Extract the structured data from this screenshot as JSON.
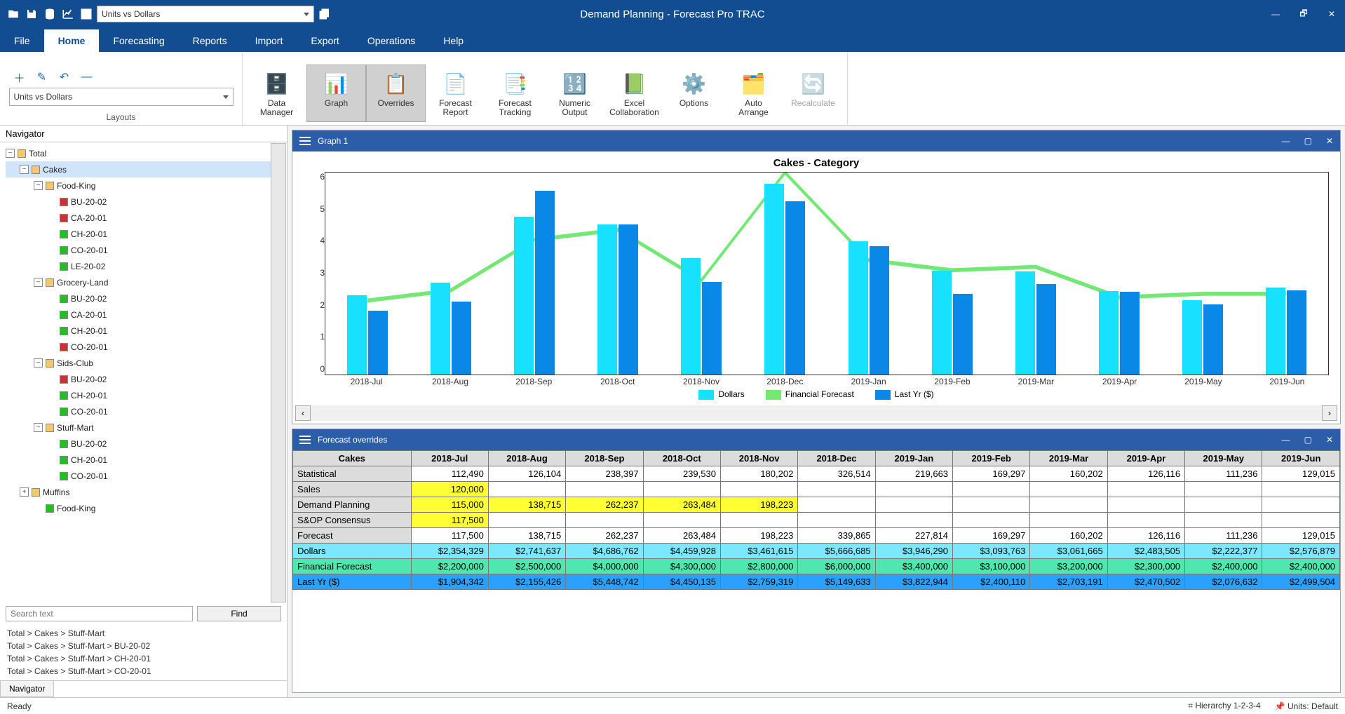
{
  "app_title": "Demand Planning - Forecast Pro TRAC",
  "layout_selected": "Units vs Dollars",
  "menubar": [
    "File",
    "Home",
    "Forecasting",
    "Reports",
    "Import",
    "Export",
    "Operations",
    "Help"
  ],
  "menubar_active": 1,
  "ribbon": {
    "layouts_label": "Layouts",
    "buttons": [
      {
        "label": "Data\nManager"
      },
      {
        "label": "Graph"
      },
      {
        "label": "Overrides"
      },
      {
        "label": "Forecast\nReport"
      },
      {
        "label": "Forecast\nTracking"
      },
      {
        "label": "Numeric\nOutput"
      },
      {
        "label": "Excel\nCollaboration"
      },
      {
        "label": "Options"
      },
      {
        "label": "Auto\nArrange"
      },
      {
        "label": "Recalculate"
      }
    ]
  },
  "navigator": {
    "title": "Navigator",
    "tree": [
      {
        "depth": 0,
        "exp": "-",
        "color": "o",
        "label": "Total"
      },
      {
        "depth": 1,
        "exp": "-",
        "color": "o",
        "label": "Cakes",
        "sel": true
      },
      {
        "depth": 2,
        "exp": "-",
        "color": "o",
        "label": "Food-King"
      },
      {
        "depth": 3,
        "color": "r",
        "label": "BU-20-02"
      },
      {
        "depth": 3,
        "color": "r",
        "label": "CA-20-01"
      },
      {
        "depth": 3,
        "color": "g",
        "label": "CH-20-01"
      },
      {
        "depth": 3,
        "color": "g",
        "label": "CO-20-01"
      },
      {
        "depth": 3,
        "color": "g",
        "label": "LE-20-02"
      },
      {
        "depth": 2,
        "exp": "-",
        "color": "o",
        "label": "Grocery-Land"
      },
      {
        "depth": 3,
        "color": "g",
        "label": "BU-20-02"
      },
      {
        "depth": 3,
        "color": "g",
        "label": "CA-20-01"
      },
      {
        "depth": 3,
        "color": "g",
        "label": "CH-20-01"
      },
      {
        "depth": 3,
        "color": "r",
        "label": "CO-20-01"
      },
      {
        "depth": 2,
        "exp": "-",
        "color": "o",
        "label": "Sids-Club"
      },
      {
        "depth": 3,
        "color": "r",
        "label": "BU-20-02"
      },
      {
        "depth": 3,
        "color": "g",
        "label": "CH-20-01"
      },
      {
        "depth": 3,
        "color": "g",
        "label": "CO-20-01"
      },
      {
        "depth": 2,
        "exp": "-",
        "color": "o",
        "label": "Stuff-Mart"
      },
      {
        "depth": 3,
        "color": "g",
        "label": "BU-20-02"
      },
      {
        "depth": 3,
        "color": "g",
        "label": "CH-20-01"
      },
      {
        "depth": 3,
        "color": "g",
        "label": "CO-20-01"
      },
      {
        "depth": 1,
        "exp": "+",
        "color": "o",
        "label": "Muffins"
      },
      {
        "depth": 2,
        "color": "g",
        "label": "Food-King"
      }
    ],
    "search_placeholder": "Search text",
    "find_label": "Find",
    "paths": [
      "Total > Cakes > Stuff-Mart",
      "Total > Cakes > Stuff-Mart > BU-20-02",
      "Total > Cakes > Stuff-Mart > CH-20-01",
      "Total > Cakes > Stuff-Mart > CO-20-01"
    ],
    "tab": "Navigator"
  },
  "graph_title": "Graph 1",
  "chart_data": {
    "type": "bar",
    "title": "Cakes - Category",
    "ylim": [
      0,
      6
    ],
    "yticks": [
      0,
      1,
      2,
      3,
      4,
      5,
      6
    ],
    "categories": [
      "2018-Jul",
      "2018-Aug",
      "2018-Sep",
      "2018-Oct",
      "2018-Nov",
      "2018-Dec",
      "2019-Jan",
      "2019-Feb",
      "2019-Mar",
      "2019-Apr",
      "2019-May",
      "2019-Jun"
    ],
    "series": [
      {
        "name": "Dollars",
        "color": "#18e1ff",
        "values": [
          2.35,
          2.74,
          4.69,
          4.46,
          3.46,
          5.67,
          3.95,
          3.09,
          3.06,
          2.48,
          2.22,
          2.58
        ]
      },
      {
        "name": "Last Yr ($)",
        "color": "#0a88e8",
        "values": [
          1.9,
          2.16,
          5.45,
          4.45,
          2.76,
          5.15,
          3.82,
          2.4,
          2.7,
          2.47,
          2.08,
          2.5
        ]
      }
    ],
    "line_series": {
      "name": "Financial Forecast",
      "color": "#74e874",
      "values": [
        2.2,
        2.5,
        4.0,
        4.3,
        2.8,
        6.0,
        3.4,
        3.1,
        3.2,
        2.3,
        2.4,
        2.4
      ]
    }
  },
  "overrides": {
    "title": "Forecast overrides",
    "corner": "Cakes",
    "columns": [
      "2018-Jul",
      "2018-Aug",
      "2018-Sep",
      "2018-Oct",
      "2018-Nov",
      "2018-Dec",
      "2019-Jan",
      "2019-Feb",
      "2019-Mar",
      "2019-Apr",
      "2019-May",
      "2019-Jun"
    ],
    "rows": [
      {
        "name": "Statistical",
        "style": "plain",
        "values": [
          "112,490",
          "126,104",
          "238,397",
          "239,530",
          "180,202",
          "326,514",
          "219,663",
          "169,297",
          "160,202",
          "126,116",
          "111,236",
          "129,015"
        ]
      },
      {
        "name": "Sales",
        "style": "yellow",
        "values": [
          "120,000",
          "",
          "",
          "",
          "",
          "",
          "",
          "",
          "",
          "",
          "",
          ""
        ]
      },
      {
        "name": "Demand Planning",
        "style": "yellow",
        "values": [
          "115,000",
          "138,715",
          "262,237",
          "263,484",
          "198,223",
          "",
          "",
          "",
          "",
          "",
          "",
          ""
        ]
      },
      {
        "name": "S&OP Consensus",
        "style": "yellow",
        "values": [
          "117,500",
          "",
          "",
          "",
          "",
          "",
          "",
          "",
          "",
          "",
          "",
          ""
        ]
      },
      {
        "name": "Forecast",
        "style": "plain",
        "values": [
          "117,500",
          "138,715",
          "262,237",
          "263,484",
          "198,223",
          "339,865",
          "227,814",
          "169,297",
          "160,202",
          "126,116",
          "111,236",
          "129,015"
        ]
      },
      {
        "name": "Dollars",
        "style": "cyan",
        "values": [
          "$2,354,329",
          "$2,741,637",
          "$4,686,762",
          "$4,459,928",
          "$3,461,615",
          "$5,666,685",
          "$3,946,290",
          "$3,093,763",
          "$3,061,665",
          "$2,483,505",
          "$2,222,377",
          "$2,576,879"
        ]
      },
      {
        "name": "Financial Forecast",
        "style": "green",
        "values": [
          "$2,200,000",
          "$2,500,000",
          "$4,000,000",
          "$4,300,000",
          "$2,800,000",
          "$6,000,000",
          "$3,400,000",
          "$3,100,000",
          "$3,200,000",
          "$2,300,000",
          "$2,400,000",
          "$2,400,000"
        ]
      },
      {
        "name": "Last Yr ($)",
        "style": "blue",
        "values": [
          "$1,904,342",
          "$2,155,426",
          "$5,448,742",
          "$4,450,135",
          "$2,759,319",
          "$5,149,633",
          "$3,822,944",
          "$2,400,110",
          "$2,703,191",
          "$2,470,502",
          "$2,076,632",
          "$2,499,504"
        ]
      }
    ]
  },
  "status": {
    "ready": "Ready",
    "hierarchy": "Hierarchy 1-2-3-4",
    "units": "Units: Default"
  }
}
